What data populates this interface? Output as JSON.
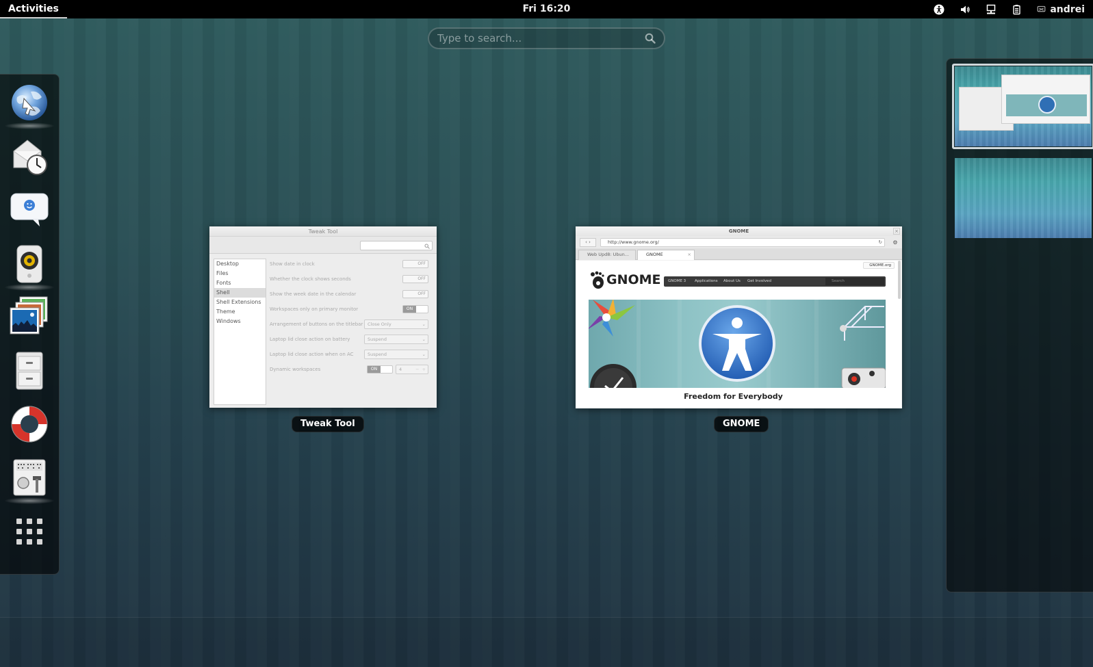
{
  "topbar": {
    "activities": "Activities",
    "clock": "Fri 16:20",
    "user": "andrei",
    "status_icons": [
      "accessibility-icon",
      "volume-icon",
      "network-icon",
      "battery-icon",
      "chat-status-icon"
    ]
  },
  "search": {
    "placeholder": "Type to search..."
  },
  "dash": {
    "items": [
      {
        "name": "web-browser",
        "running": true
      },
      {
        "name": "evolution-mail-calendar",
        "running": false
      },
      {
        "name": "empathy-chat",
        "running": false
      },
      {
        "name": "rhythmbox-music",
        "running": true
      },
      {
        "name": "shotwell-photos",
        "running": false
      },
      {
        "name": "files-cabinet",
        "running": false
      },
      {
        "name": "help-lifebuoy",
        "running": false
      },
      {
        "name": "tweak-tool",
        "running": true
      },
      {
        "name": "show-applications",
        "running": false
      }
    ]
  },
  "windows": {
    "tweak": {
      "caption": "Tweak Tool",
      "title": "Tweak Tool",
      "sidebar": [
        "Desktop",
        "Files",
        "Fonts",
        "Shell",
        "Shell Extensions",
        "Theme",
        "Windows"
      ],
      "selected": "Shell",
      "rows": [
        {
          "label": "Show date in clock",
          "control": "OFF"
        },
        {
          "label": "Whether the clock shows seconds",
          "control": "OFF"
        },
        {
          "label": "Show the week date in the calendar",
          "control": "OFF"
        },
        {
          "label": "Workspaces only on primary monitor",
          "control": "ON"
        },
        {
          "label": "Arrangement of buttons on the titlebar",
          "control": "Close Only"
        },
        {
          "label": "Laptop lid close action on battery",
          "control": "Suspend"
        },
        {
          "label": "Laptop lid close action when on AC",
          "control": "Suspend"
        },
        {
          "label": "Dynamic workspaces",
          "control": "ON",
          "spin": "4"
        }
      ]
    },
    "browser": {
      "caption": "GNOME",
      "title": "GNOME",
      "url": "http://www.gnome.org/",
      "tabs": [
        "Web Upd8: Ubun...",
        "GNOME"
      ],
      "site_badge": "GNOME.org",
      "logo": "GNOME",
      "menu": [
        "GNOME 3",
        "Applications",
        "About Us",
        "Get Involved"
      ],
      "menu_search": "Search",
      "tagline": "Freedom for Everybody"
    }
  },
  "workspaces": {
    "count": 2,
    "active": 0
  },
  "colors": {
    "panel": "#000000",
    "accent_blue": "#2f6fb5",
    "search_text": "#ffffff"
  }
}
